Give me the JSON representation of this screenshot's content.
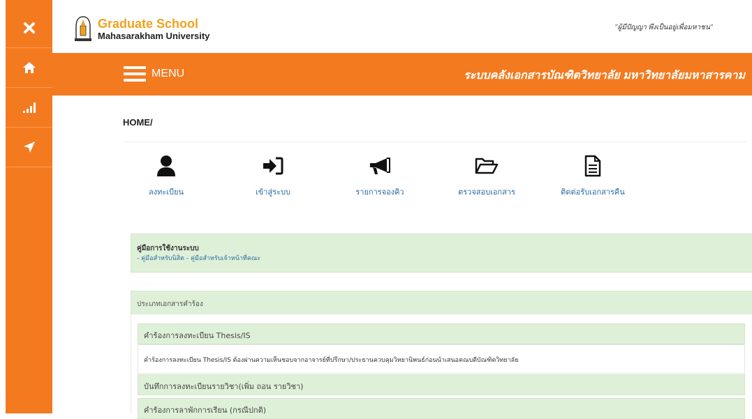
{
  "sidebar": {
    "items": [
      {
        "icon": "close-icon"
      },
      {
        "icon": "home-icon"
      },
      {
        "icon": "signal-icon"
      },
      {
        "icon": "location-arrow-icon"
      }
    ]
  },
  "header": {
    "brand_line1": "Graduate School",
    "brand_line2": "Mahasarakham University",
    "motto": "\"ผู้มีปัญญา พึงเป็นอยู่เพื่อมหาชน\""
  },
  "menubar": {
    "menu_label": "MENU",
    "system_title": "ระบบคลังเอกสารบัณฑิตวิทยาลัย มหาวิทยาลัยมหาสารคาม"
  },
  "breadcrumb": "HOME/",
  "actions": [
    {
      "label": "ลงทะเบียน",
      "icon": "user-icon"
    },
    {
      "label": "เข้าสู่ระบบ",
      "icon": "sign-in-icon"
    },
    {
      "label": "รายการจองคิว",
      "icon": "bullhorn-icon"
    },
    {
      "label": "ตรวจสอบเอกสาร",
      "icon": "folder-open-icon"
    },
    {
      "label": "ติดต่อรับเอกสารคืน",
      "icon": "file-text-icon"
    }
  ],
  "manual": {
    "title": "คู่มือการใช้งานระบบ",
    "prefix": "- ",
    "link_student": "คู่มือสำหรับนิสิต",
    "separator": " - ",
    "link_staff": "คู่มือสำหรับเจ้าหน้าที่คณะ"
  },
  "request_types": {
    "header": "ประเภทเอกสารคำร้อง",
    "items": [
      {
        "title": "คำร้องการลงทะเบียน Thesis/IS",
        "body": "คำร้องการลงทะเบียน Thesis/IS ต้องผ่านความเห็นชอบจากอาจารย์ที่ปรึกษา/ประธานควบคุมวิทยานิพนธ์ก่อนนำเสนอคณบดีบัณฑิตวิทยาลัย"
      },
      {
        "title": "บันทึกการลงทะเบียนรายวิชา(เพิ่ม ถอน รายวิชา)"
      },
      {
        "title": "คำร้องการลาพักการเรียน (กรณีปกติ)"
      }
    ]
  },
  "colors": {
    "accent": "#f47a20",
    "panel_green": "#dff0d8",
    "link": "#2a6aa3",
    "brand_gold": "#f0a21e"
  }
}
